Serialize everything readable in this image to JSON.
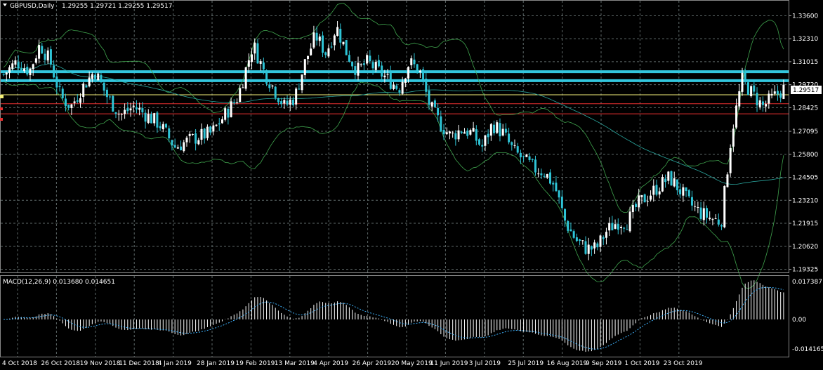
{
  "header": {
    "symbol": "GBPUSD,Daily",
    "ohlc": "1.29255 1.29721 1.29255 1.29517"
  },
  "macd": {
    "label": "MACD(12,26,9) 0.013680 0.014651",
    "ticks": [
      "0.017387",
      "0.00",
      "-0.014165"
    ]
  },
  "current_price": "1.29517",
  "colors": {
    "background": "#000000",
    "grid": "#5f6a6a",
    "bull": "#ffffff",
    "bear": "#2ec4d6",
    "bands": "#3fa34d",
    "ma": "#2aa8a0",
    "level_cyan": "#33c6dd",
    "level_yellow": "#f5f07a",
    "level_red": "#e83030",
    "histogram": "#ffffff",
    "signal": "#3fb3ff"
  },
  "chart_data": {
    "type": "candlestick",
    "price_ticks": [
      1.336,
      1.3231,
      1.31015,
      1.2972,
      1.28425,
      1.27095,
      1.258,
      1.24505,
      1.2321,
      1.21915,
      1.2062,
      1.19325
    ],
    "price_tick_labels": [
      "1.33600",
      "1.32310",
      "1.31015",
      "1.29720",
      "1.28425",
      "1.27095",
      "1.25800",
      "1.24505",
      "1.23210",
      "1.21915",
      "1.20620",
      "1.19325"
    ],
    "ylim": [
      1.1915,
      1.3445
    ],
    "date_labels": [
      "4 Oct 2018",
      "26 Oct 2018",
      "19 Nov 2018",
      "11 Dec 2018",
      "4 Jan 2019",
      "28 Jan 2019",
      "19 Feb 2019",
      "13 Mar 2019",
      "4 Apr 2019",
      "26 Apr 2019",
      "20 May 2019",
      "11 Jun 2019",
      "3 Jul 2019",
      "25 Jul 2019",
      "16 Aug 2019",
      "9 Sep 2019",
      "1 Oct 2019",
      "23 Oct 2019"
    ],
    "horizontal_levels": [
      {
        "price": 1.3045,
        "color": "#33c6dd",
        "width": 4
      },
      {
        "price": 1.2995,
        "color": "#33c6dd",
        "width": 4
      },
      {
        "price": 1.2915,
        "color": "#f5f07a",
        "width": 1
      },
      {
        "price": 1.2865,
        "color": "#e83030",
        "width": 1
      },
      {
        "price": 1.2808,
        "color": "#e83030",
        "width": 1
      }
    ],
    "close_path": [
      [
        0,
        1.303
      ],
      [
        5,
        1.31
      ],
      [
        10,
        1.305
      ],
      [
        14,
        1.32
      ],
      [
        18,
        1.31
      ],
      [
        22,
        1.29
      ],
      [
        26,
        1.285
      ],
      [
        30,
        1.295
      ],
      [
        35,
        1.305
      ],
      [
        40,
        1.29
      ],
      [
        45,
        1.28
      ],
      [
        50,
        1.285
      ],
      [
        55,
        1.28
      ],
      [
        60,
        1.275
      ],
      [
        66,
        1.262
      ],
      [
        70,
        1.265
      ],
      [
        75,
        1.268
      ],
      [
        80,
        1.27
      ],
      [
        85,
        1.28
      ],
      [
        90,
        1.29
      ],
      [
        96,
        1.32
      ],
      [
        100,
        1.305
      ],
      [
        104,
        1.295
      ],
      [
        108,
        1.285
      ],
      [
        112,
        1.29
      ],
      [
        116,
        1.31
      ],
      [
        120,
        1.325
      ],
      [
        124,
        1.315
      ],
      [
        128,
        1.33
      ],
      [
        132,
        1.315
      ],
      [
        136,
        1.305
      ],
      [
        140,
        1.31
      ],
      [
        144,
        1.305
      ],
      [
        148,
        1.3
      ],
      [
        152,
        1.295
      ],
      [
        156,
        1.31
      ],
      [
        160,
        1.305
      ],
      [
        164,
        1.285
      ],
      [
        168,
        1.275
      ],
      [
        172,
        1.268
      ],
      [
        176,
        1.272
      ],
      [
        180,
        1.27
      ],
      [
        184,
        1.262
      ],
      [
        188,
        1.275
      ],
      [
        192,
        1.27
      ],
      [
        196,
        1.26
      ],
      [
        200,
        1.255
      ],
      [
        204,
        1.25
      ],
      [
        208,
        1.248
      ],
      [
        212,
        1.24
      ],
      [
        216,
        1.22
      ],
      [
        220,
        1.21
      ],
      [
        224,
        1.205
      ],
      [
        228,
        1.205
      ],
      [
        232,
        1.215
      ],
      [
        236,
        1.22
      ],
      [
        240,
        1.22
      ],
      [
        244,
        1.23
      ],
      [
        248,
        1.235
      ],
      [
        252,
        1.24
      ],
      [
        256,
        1.245
      ],
      [
        260,
        1.238
      ],
      [
        264,
        1.23
      ],
      [
        268,
        1.225
      ],
      [
        272,
        1.222
      ],
      [
        276,
        1.22
      ],
      [
        280,
        1.27
      ],
      [
        284,
        1.3
      ],
      [
        288,
        1.292
      ],
      [
        292,
        1.285
      ],
      [
        296,
        1.29
      ],
      [
        300,
        1.295
      ]
    ],
    "macd_ticks": [
      0.017387,
      0.0,
      -0.014165
    ]
  }
}
